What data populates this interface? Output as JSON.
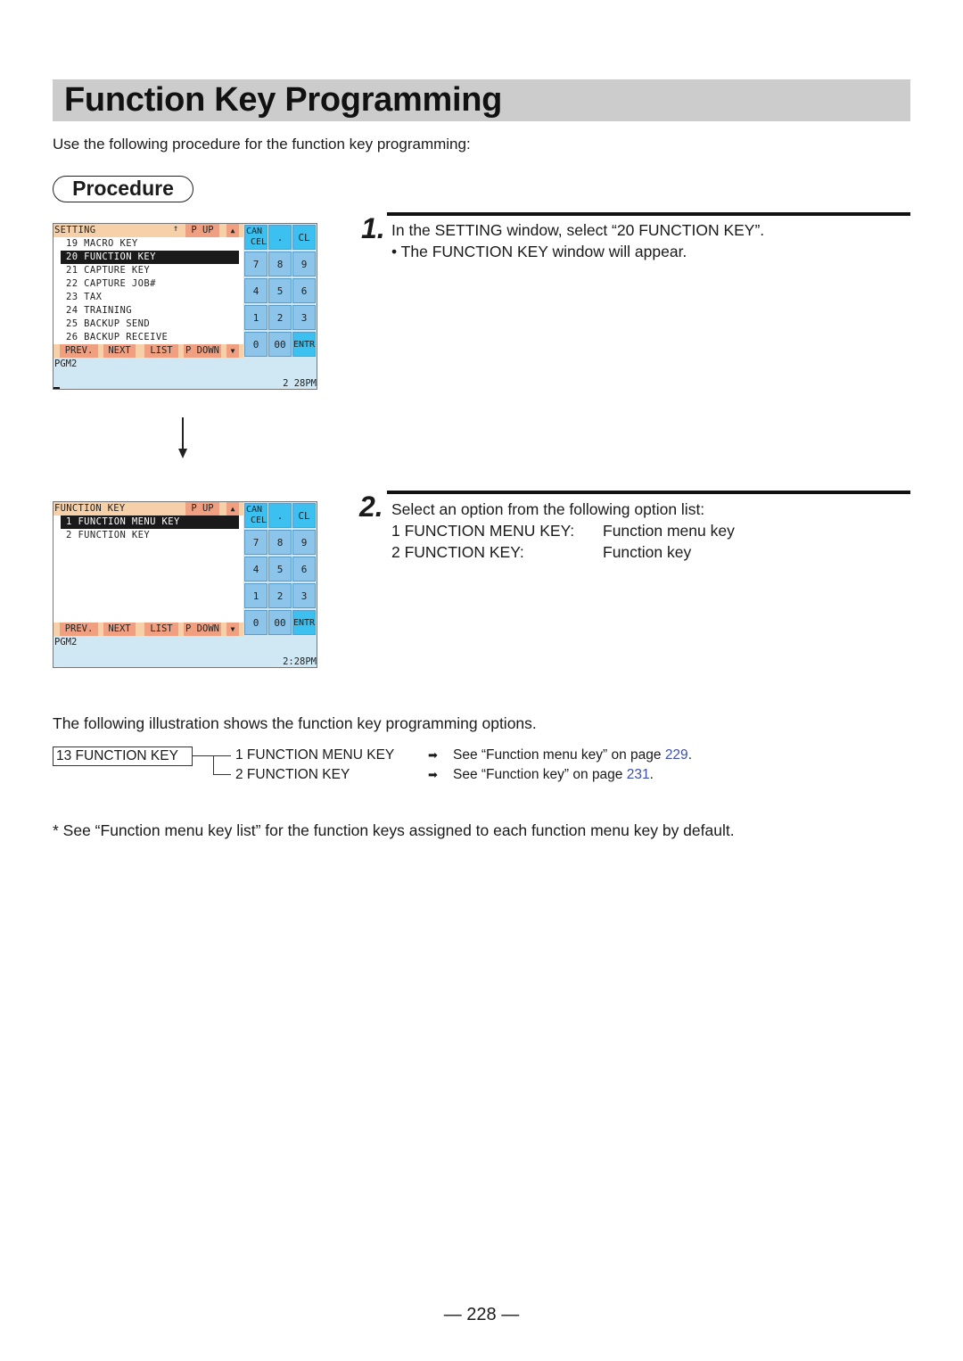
{
  "page": {
    "title": "Function Key Programming",
    "intro": "Use the following procedure for the function key programming:",
    "procedure_label": "Procedure",
    "page_number": "— 228 —"
  },
  "screens": {
    "setting": {
      "header_title": "SETTING",
      "header_arrow": "↑",
      "p_up": "P UP",
      "up_tri": "▲",
      "items": [
        {
          "label": "19 MACRO KEY",
          "selected": false
        },
        {
          "label": "20 FUNCTION KEY",
          "selected": true
        },
        {
          "label": "21 CAPTURE KEY",
          "selected": false
        },
        {
          "label": "22 CAPTURE JOB#",
          "selected": false
        },
        {
          "label": "23 TAX",
          "selected": false
        },
        {
          "label": "24 TRAINING",
          "selected": false
        },
        {
          "label": "25 BACKUP SEND",
          "selected": false
        },
        {
          "label": "26 BACKUP RECEIVE",
          "selected": false
        }
      ],
      "footer": {
        "prev": "PREV.",
        "next": "NEXT",
        "list": "LIST",
        "p_down": "P DOWN",
        "down_tri": "▼"
      },
      "status_mode": "PGM2",
      "status_time": "2 28PM"
    },
    "function_key": {
      "header_title": "FUNCTION KEY",
      "p_up": "P UP",
      "up_tri": "▲",
      "items": [
        {
          "label": "1 FUNCTION MENU KEY",
          "selected": true
        },
        {
          "label": "2 FUNCTION KEY",
          "selected": false
        }
      ],
      "footer": {
        "prev": "PREV.",
        "next": "NEXT",
        "list": "LIST",
        "p_down": "P DOWN",
        "down_tri": "▼"
      },
      "status_mode": "PGM2",
      "status_time": "2:28PM"
    },
    "keypad": {
      "cancel_top": "CAN",
      "cancel_bottom": "CEL",
      "dot": ".",
      "cl": "CL",
      "k7": "7",
      "k8": "8",
      "k9": "9",
      "k4": "4",
      "k5": "5",
      "k6": "6",
      "k1": "1",
      "k2": "2",
      "k3": "3",
      "k0": "0",
      "k00": "00",
      "entr": "ENTR"
    }
  },
  "steps": [
    {
      "number": "1.",
      "text": "In the SETTING window, select “20 FUNCTION KEY”.",
      "bullet": "• The FUNCTION KEY window will appear."
    },
    {
      "number": "2.",
      "text": "Select an option from the following option list:",
      "options": [
        {
          "key": "1 FUNCTION MENU KEY:",
          "desc": "Function menu key"
        },
        {
          "key": "2 FUNCTION KEY:",
          "desc": "Function key"
        }
      ]
    }
  ],
  "illustration": {
    "caption": "The following illustration shows the function key programming options.",
    "root": "13 FUNCTION KEY",
    "branches": [
      {
        "label": "1  FUNCTION MENU KEY",
        "arrow": "➡",
        "ref_prefix": "See “Function menu key” on page ",
        "page": "229",
        "ref_suffix": "."
      },
      {
        "label": "2  FUNCTION KEY",
        "arrow": "➡",
        "ref_prefix": "See “Function key” on page ",
        "page": "231",
        "ref_suffix": "."
      }
    ]
  },
  "footnote": "* See “Function menu key list” for the function keys assigned to each function menu key by default.",
  "colors": {
    "title_bar": "#cccccc",
    "pos_header": "#f6d0a8",
    "pos_button": "#f0a080",
    "pos_key": "#8cc4ea",
    "pos_key_accent": "#3cc0f0",
    "pos_status": "#cfe8f4",
    "link": "#3b4fa8"
  }
}
